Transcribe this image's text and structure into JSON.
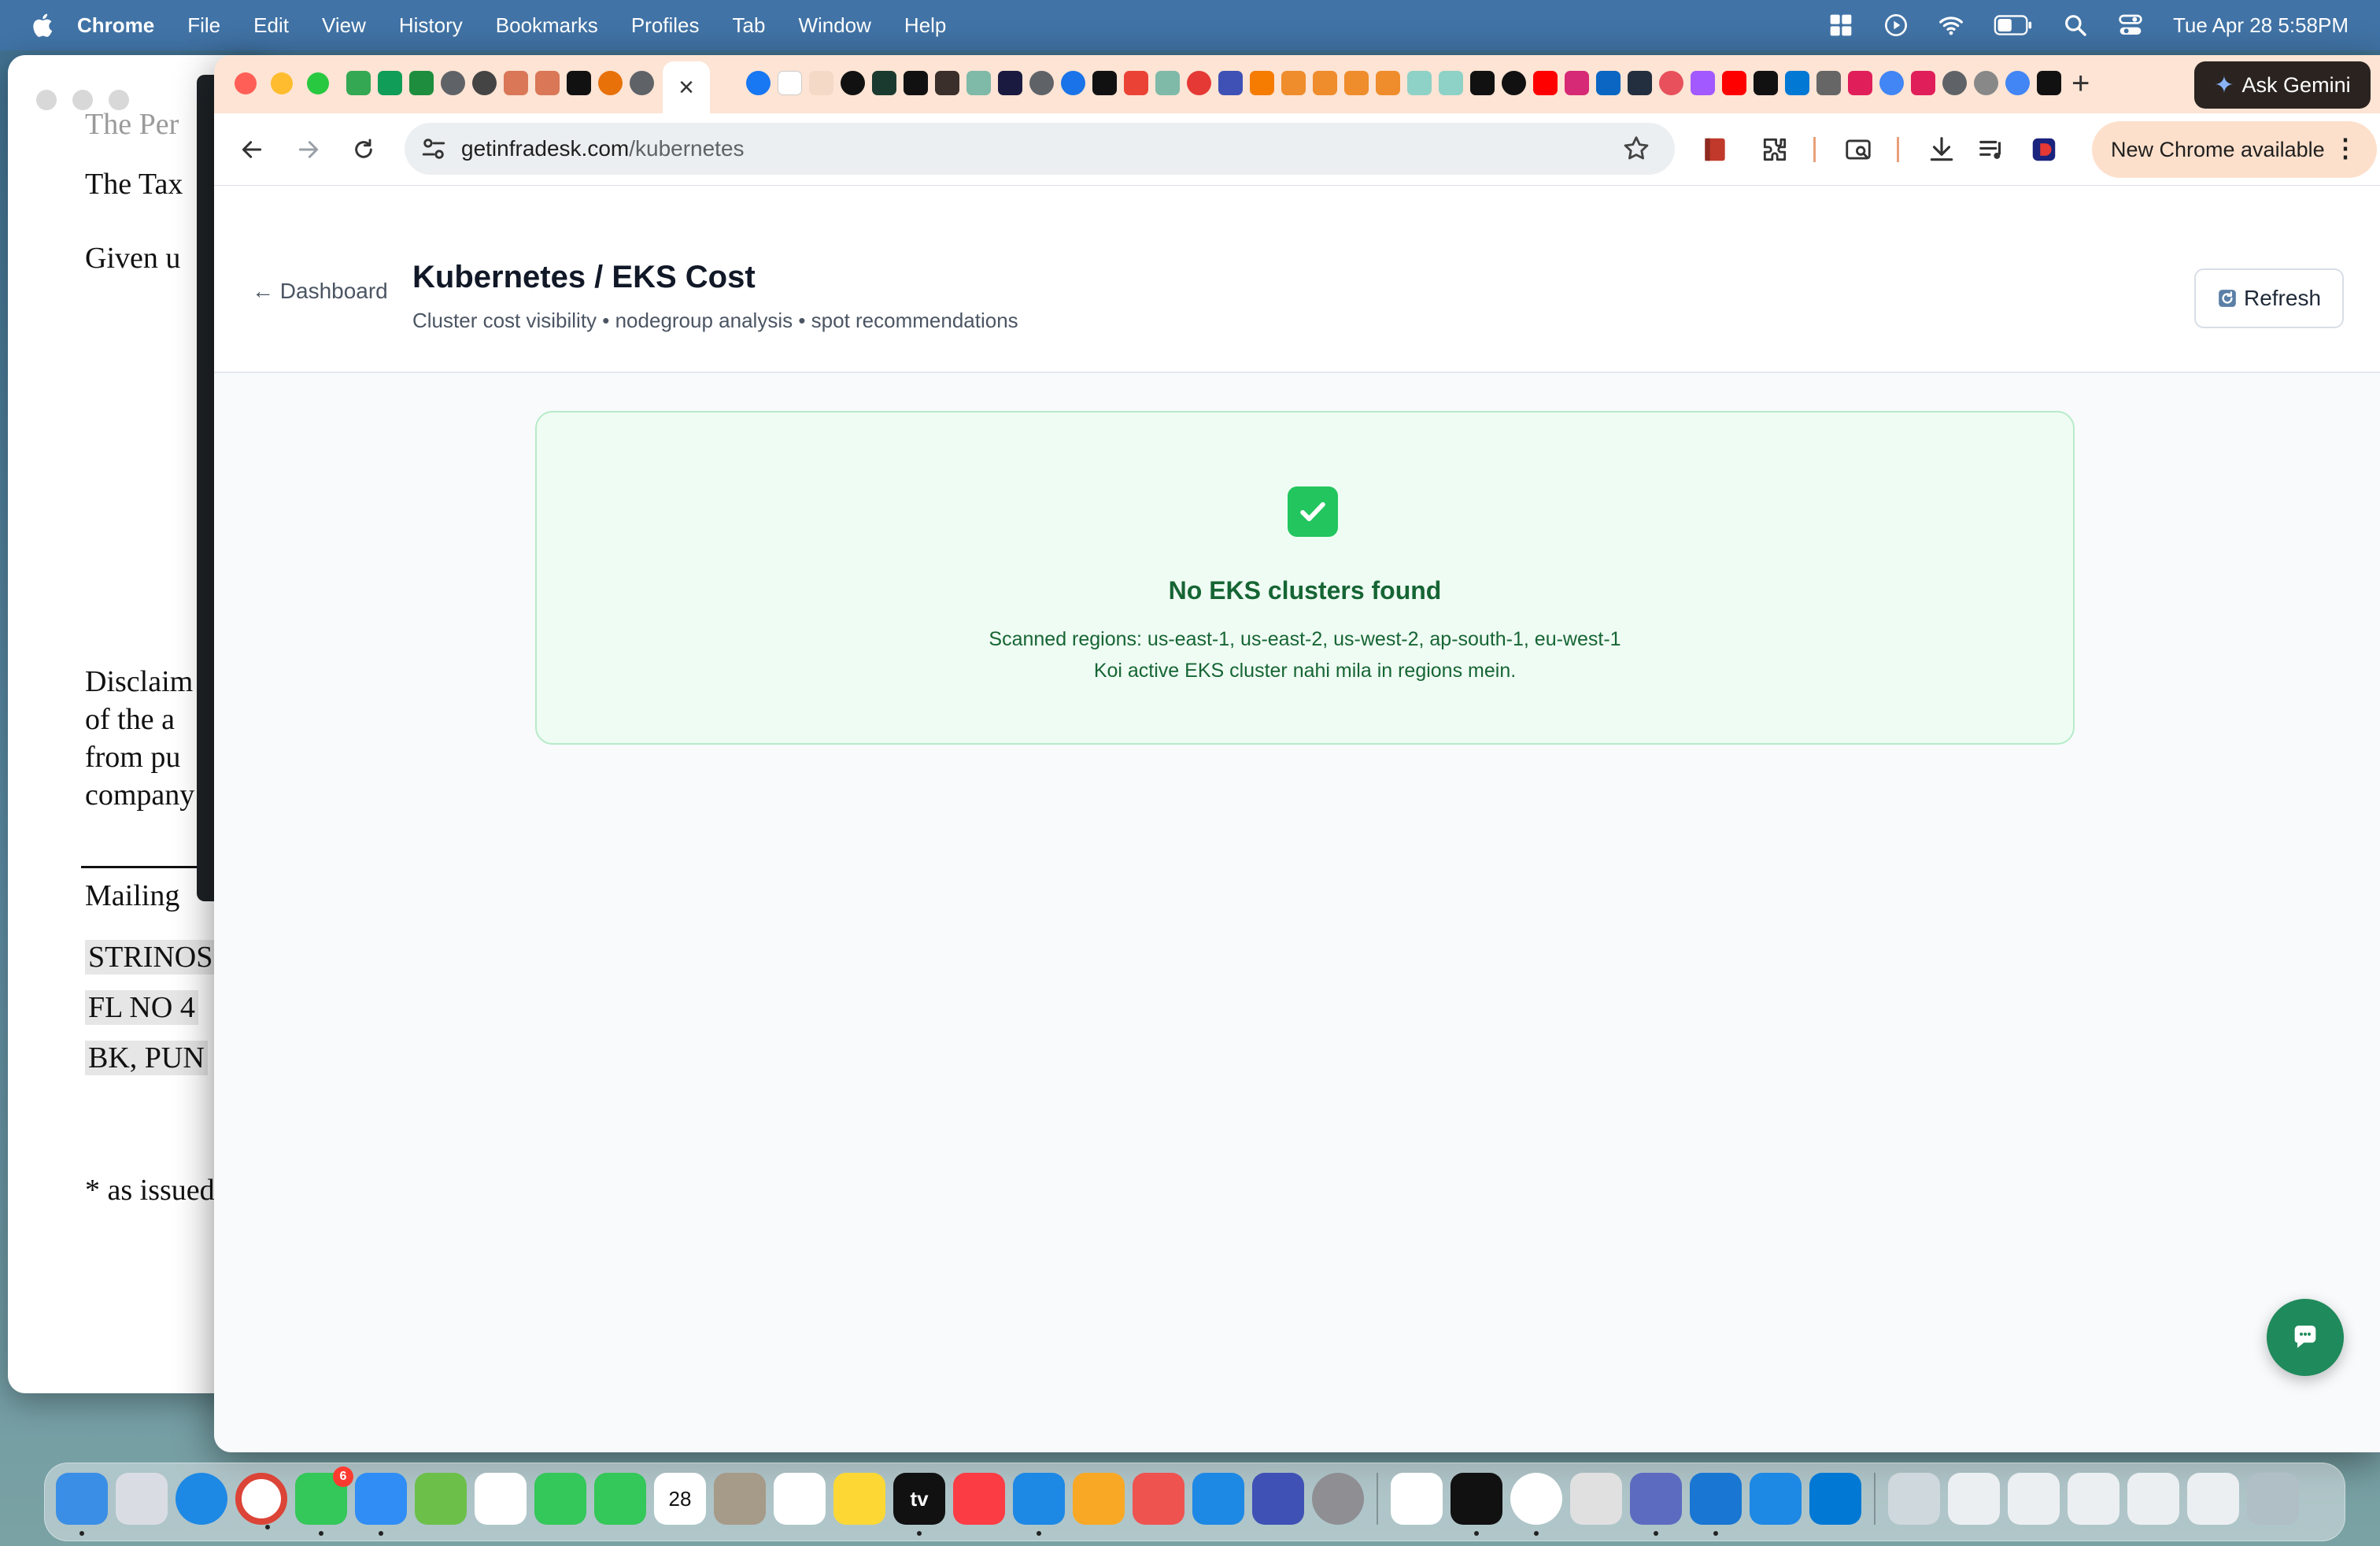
{
  "menubar": {
    "app_name": "Chrome",
    "items": [
      "File",
      "Edit",
      "View",
      "History",
      "Bookmarks",
      "Profiles",
      "Tab",
      "Window",
      "Help"
    ],
    "clock": "Tue Apr 28  5:58PM",
    "status_icons": [
      "windows-grid-icon",
      "play-circle-icon",
      "wifi-icon",
      "battery-icon",
      "spotlight-search-icon",
      "control-center-icon"
    ]
  },
  "background_document": {
    "lines": [
      "The Per",
      "The Tax",
      "Given u",
      "Disclaim",
      "of the a",
      "from pu",
      "company",
      "Mailing",
      "STRINOS",
      "FL NO 4",
      "BK, PUN",
      "* as issued"
    ]
  },
  "chrome": {
    "active_tab_close": "×",
    "new_tab": "+",
    "ask_gemini": "Ask Gemini",
    "url_host": "getinfradesk.com",
    "url_path": "/kubernetes",
    "new_chrome_available": "New Chrome available",
    "menu_dots": "⋮"
  },
  "page": {
    "back_link": "← Dashboard",
    "title": "Kubernetes / EKS Cost",
    "subtitle": "Cluster cost visibility • nodegroup analysis • spot recommendations",
    "refresh_label": "Refresh",
    "empty_state": {
      "title": "No EKS clusters found",
      "scanned_regions": "Scanned regions: us-east-1, us-east-2, us-west-2, ap-south-1, eu-west-1",
      "message": "Koi active EKS cluster nahi mila in regions mein."
    }
  },
  "dock": {
    "messages_badge": "6",
    "calendar_day": "28",
    "tv_label": "tv"
  },
  "colors": {
    "accent_green": "#166534",
    "card_bg": "#effcf3",
    "fab": "#1f8a5b",
    "menubar": "#4173a6",
    "tabstrip": "#fde4d4"
  }
}
